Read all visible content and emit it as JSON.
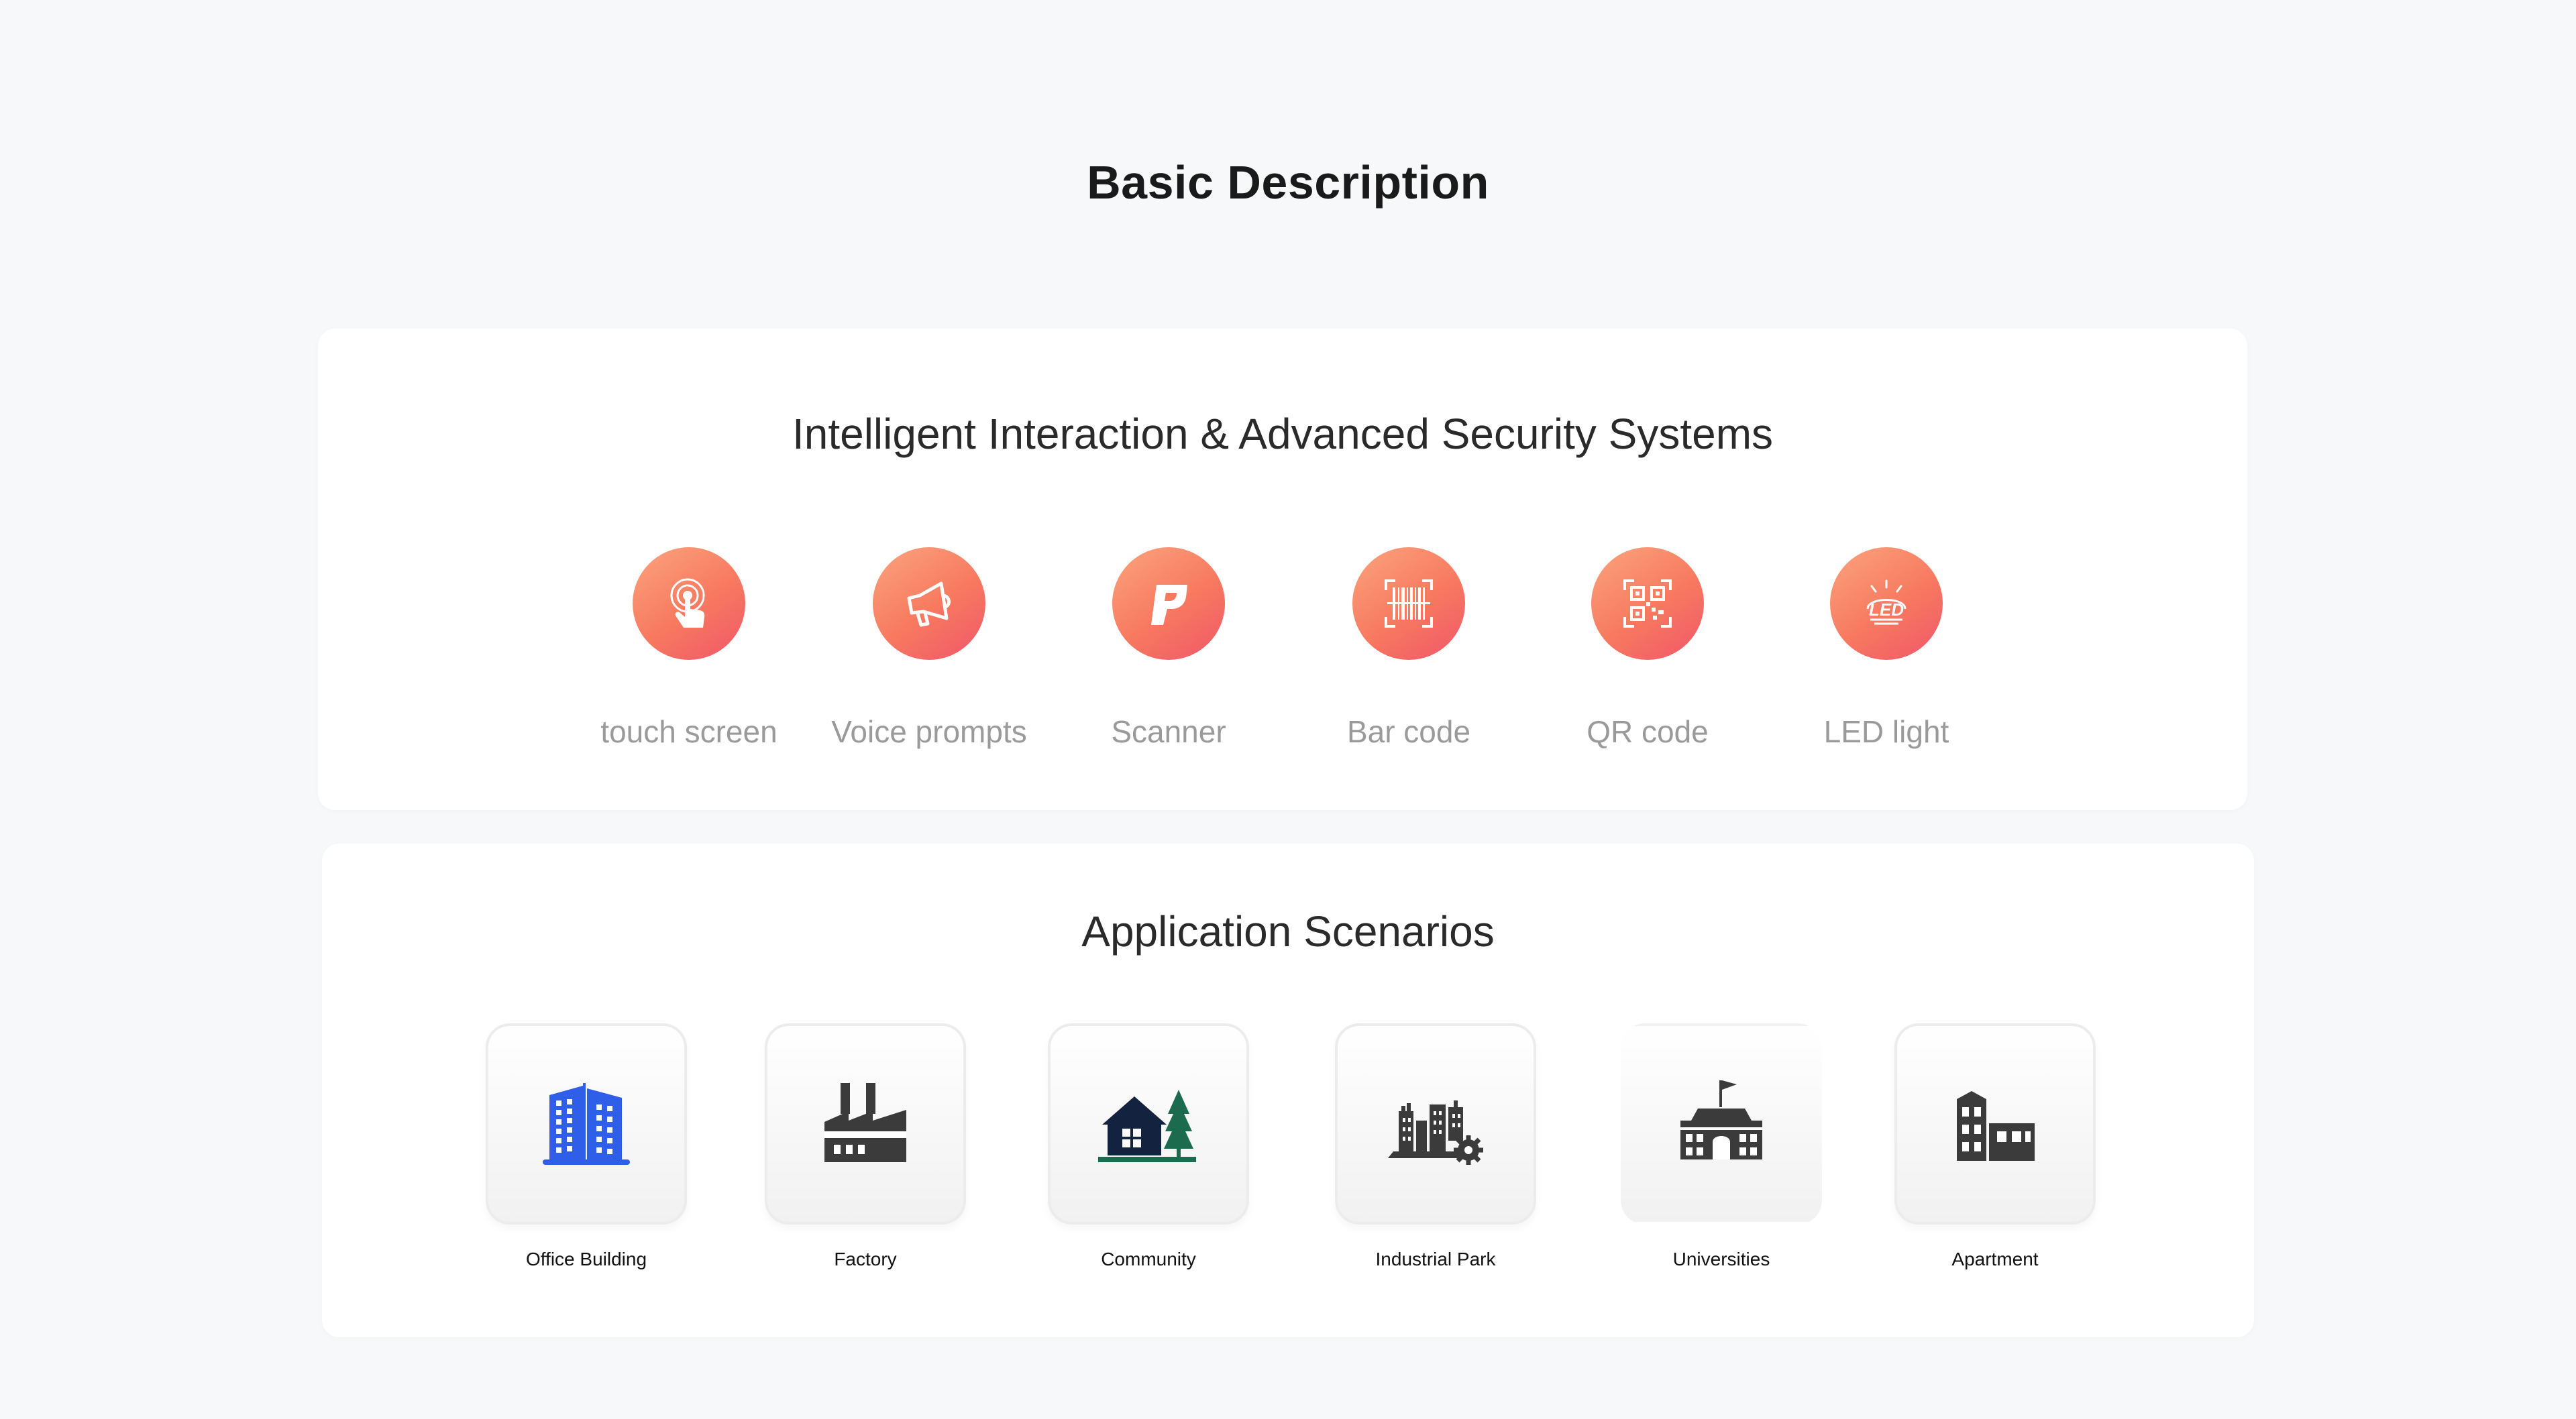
{
  "page": {
    "title": "Basic Description"
  },
  "features": {
    "title": "Intelligent Interaction & Advanced Security Systems",
    "gradient": [
      "#fba47e",
      "#f7795f",
      "#f0566a"
    ],
    "items": [
      {
        "label": "touch screen",
        "icon": "touch-icon"
      },
      {
        "label": "Voice prompts",
        "icon": "megaphone-icon"
      },
      {
        "label": "Scanner",
        "icon": "scanner-icon"
      },
      {
        "label": "Bar code",
        "icon": "barcode-icon"
      },
      {
        "label": "QR code",
        "icon": "qrcode-icon"
      },
      {
        "label": "LED light",
        "icon": "led-icon",
        "icon_text": "LED"
      }
    ]
  },
  "scenarios": {
    "title": "Application Scenarios",
    "items": [
      {
        "label": "Office Building",
        "icon": "office-building-icon",
        "color": "#2f5fe8"
      },
      {
        "label": "Factory",
        "icon": "factory-icon",
        "color": "#3b3b3b"
      },
      {
        "label": "Community",
        "icon": "community-icon",
        "color": "#13233f"
      },
      {
        "label": "Industrial Park",
        "icon": "industrial-park-icon",
        "color": "#3b3b3b"
      },
      {
        "label": "Universities",
        "icon": "university-icon",
        "color": "#3b3b3b"
      },
      {
        "label": "Apartment",
        "icon": "apartment-icon",
        "color": "#3b3b3b"
      }
    ]
  }
}
